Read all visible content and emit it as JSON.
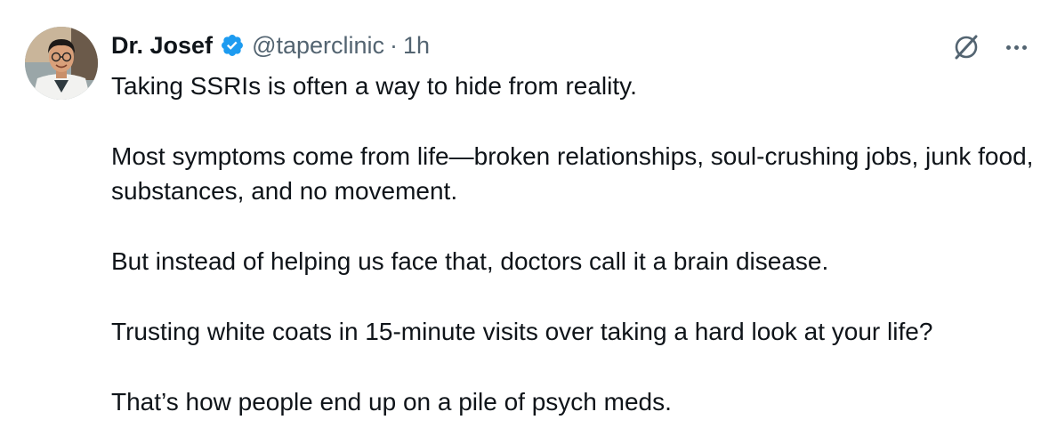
{
  "author": {
    "display_name": "Dr. Josef",
    "handle": "@taperclinic",
    "separator": "·",
    "time": "1h",
    "verified_color": "#1d9bf0"
  },
  "icons": {
    "grok": "grok-icon",
    "more": "more-icon",
    "verified": "verified-badge-icon"
  },
  "tweet": {
    "paragraphs": [
      "Taking SSRIs is often a way to hide from reality.",
      "Most symptoms come from life—broken relationships, soul-crushing jobs, junk food, substances, and no movement.",
      "But instead of helping us face that, doctors call it a brain disease.",
      "Trusting white coats in 15-minute visits over taking a hard look at your life?",
      "That’s how people end up on a pile of psych meds."
    ]
  }
}
